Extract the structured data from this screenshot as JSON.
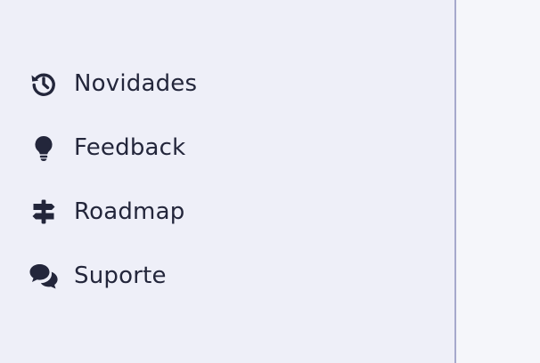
{
  "sidebar": {
    "items": [
      {
        "label": "Novidades",
        "icon": "history-icon"
      },
      {
        "label": "Feedback",
        "icon": "lightbulb-icon"
      },
      {
        "label": "Roadmap",
        "icon": "signpost-icon"
      },
      {
        "label": "Suporte",
        "icon": "chat-bubbles-icon"
      }
    ]
  },
  "colors": {
    "sidebar_bg": "#eeeff8",
    "content_bg": "#f5f6fa",
    "divider": "#a6a9cc",
    "text": "#23263b"
  }
}
